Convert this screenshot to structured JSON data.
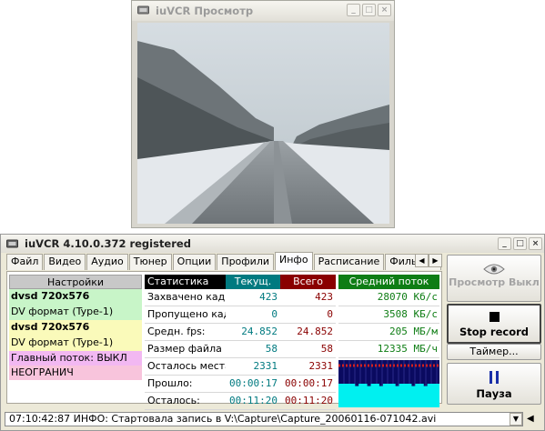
{
  "preview_window": {
    "title": "iuVCR Просмотр",
    "controls": [
      "minimize",
      "maximize",
      "close"
    ]
  },
  "main_window": {
    "title": "iuVCR 4.10.0.372 registered"
  },
  "tabs": [
    {
      "label": "Файл",
      "active": false
    },
    {
      "label": "Видео",
      "active": false
    },
    {
      "label": "Аудио",
      "active": false
    },
    {
      "label": "Тюнер",
      "active": false
    },
    {
      "label": "Опции",
      "active": false
    },
    {
      "label": "Профили",
      "active": false
    },
    {
      "label": "Инфо",
      "active": true
    },
    {
      "label": "Расписание",
      "active": false
    },
    {
      "label": "Фильтры",
      "active": false
    }
  ],
  "settings": {
    "header": "Настройки",
    "rows": [
      {
        "text": "dvsd 720x576",
        "bg": "#c8f5c8",
        "bold": true
      },
      {
        "text": "DV формат (Type-1)",
        "bg": "#c8f5c8",
        "bold": false
      },
      {
        "text": "dvsd 720x576",
        "bg": "#fafaba",
        "bold": true
      },
      {
        "text": "DV формат (Type-1)",
        "bg": "#fafaba",
        "bold": false
      },
      {
        "text": "Главный поток: ВЫКЛ",
        "bg": "#f2b8f2",
        "bold": false
      },
      {
        "text": "НЕОГРАНИЧ",
        "bg": "#f8c4dc",
        "bold": false
      }
    ]
  },
  "stats": {
    "headers": {
      "stat": "Статистика",
      "current": "Текущ.",
      "total": "Всего"
    },
    "header_colors": {
      "stat": "#000000",
      "current": "#007a80",
      "total": "#8a0000"
    },
    "rows": [
      {
        "label": "Захвачено кадров:",
        "current": "423",
        "total": "423"
      },
      {
        "label": "Пропущено кадров:",
        "current": "0",
        "total": "0"
      },
      {
        "label": "Средн. fps:",
        "current": "24.852",
        "total": "24.852"
      },
      {
        "label": "Размер файла",
        "current": "58",
        "total": "58"
      },
      {
        "label": "Осталось места:",
        "current": "2331",
        "total": "2331"
      },
      {
        "label": "Прошло:",
        "current": "00:00:17",
        "total": "00:00:17"
      },
      {
        "label": "Осталось:",
        "current": "00:11:20",
        "total": "00:11:20"
      }
    ]
  },
  "bitrate": {
    "header": "Средний поток",
    "header_color": "#0e7d14",
    "rows": [
      "28070 Кб/с",
      "3508 КБ/с",
      "205 МБ/м",
      "12335 МБ/ч"
    ]
  },
  "graph": {
    "bg": "#0a0a60",
    "fill": "#00f0f0",
    "levels": [
      0.5,
      0.5,
      0.5,
      0.5,
      0.45,
      0.5,
      0.5,
      0.45,
      0.5,
      0.5,
      0.45,
      0.5,
      0.5,
      0.5,
      0.45,
      0.5,
      0.5,
      0.5,
      0.45,
      0.5,
      0.5,
      0.45,
      0.5,
      0.5,
      0.5
    ]
  },
  "buttons": {
    "preview": "Просмотр Выкл",
    "stop_record": "Stop record",
    "timer": "Таймер...",
    "pause": "Пауза"
  },
  "status": {
    "text": "07:10:42:87 ИНФО: Стартовала запись в V:\\Capture\\Capture_20060116-071042.avi"
  }
}
